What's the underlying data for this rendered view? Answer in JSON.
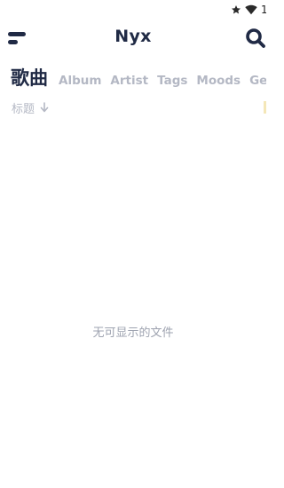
{
  "status_bar": {
    "icons": [
      "star-icon",
      "wifi-icon"
    ],
    "time_partial": "1"
  },
  "app_bar": {
    "title": "Nyx",
    "menu_icon": "menu-icon",
    "search_icon": "search-icon"
  },
  "tabs": [
    {
      "label": "歌曲",
      "active": true
    },
    {
      "label": "Album",
      "active": false
    },
    {
      "label": "Artist",
      "active": false
    },
    {
      "label": "Tags",
      "active": false
    },
    {
      "label": "Moods",
      "active": false
    },
    {
      "label": "Gen",
      "active": false
    }
  ],
  "sort": {
    "label": "标题",
    "direction_icon": "arrow-down-icon"
  },
  "empty_state": {
    "message": "无可显示的文件"
  },
  "colors": {
    "primary_text": "#202a45",
    "muted_text": "#b4b8c4",
    "empty_text": "#9ea3b0",
    "background": "#ffffff"
  }
}
